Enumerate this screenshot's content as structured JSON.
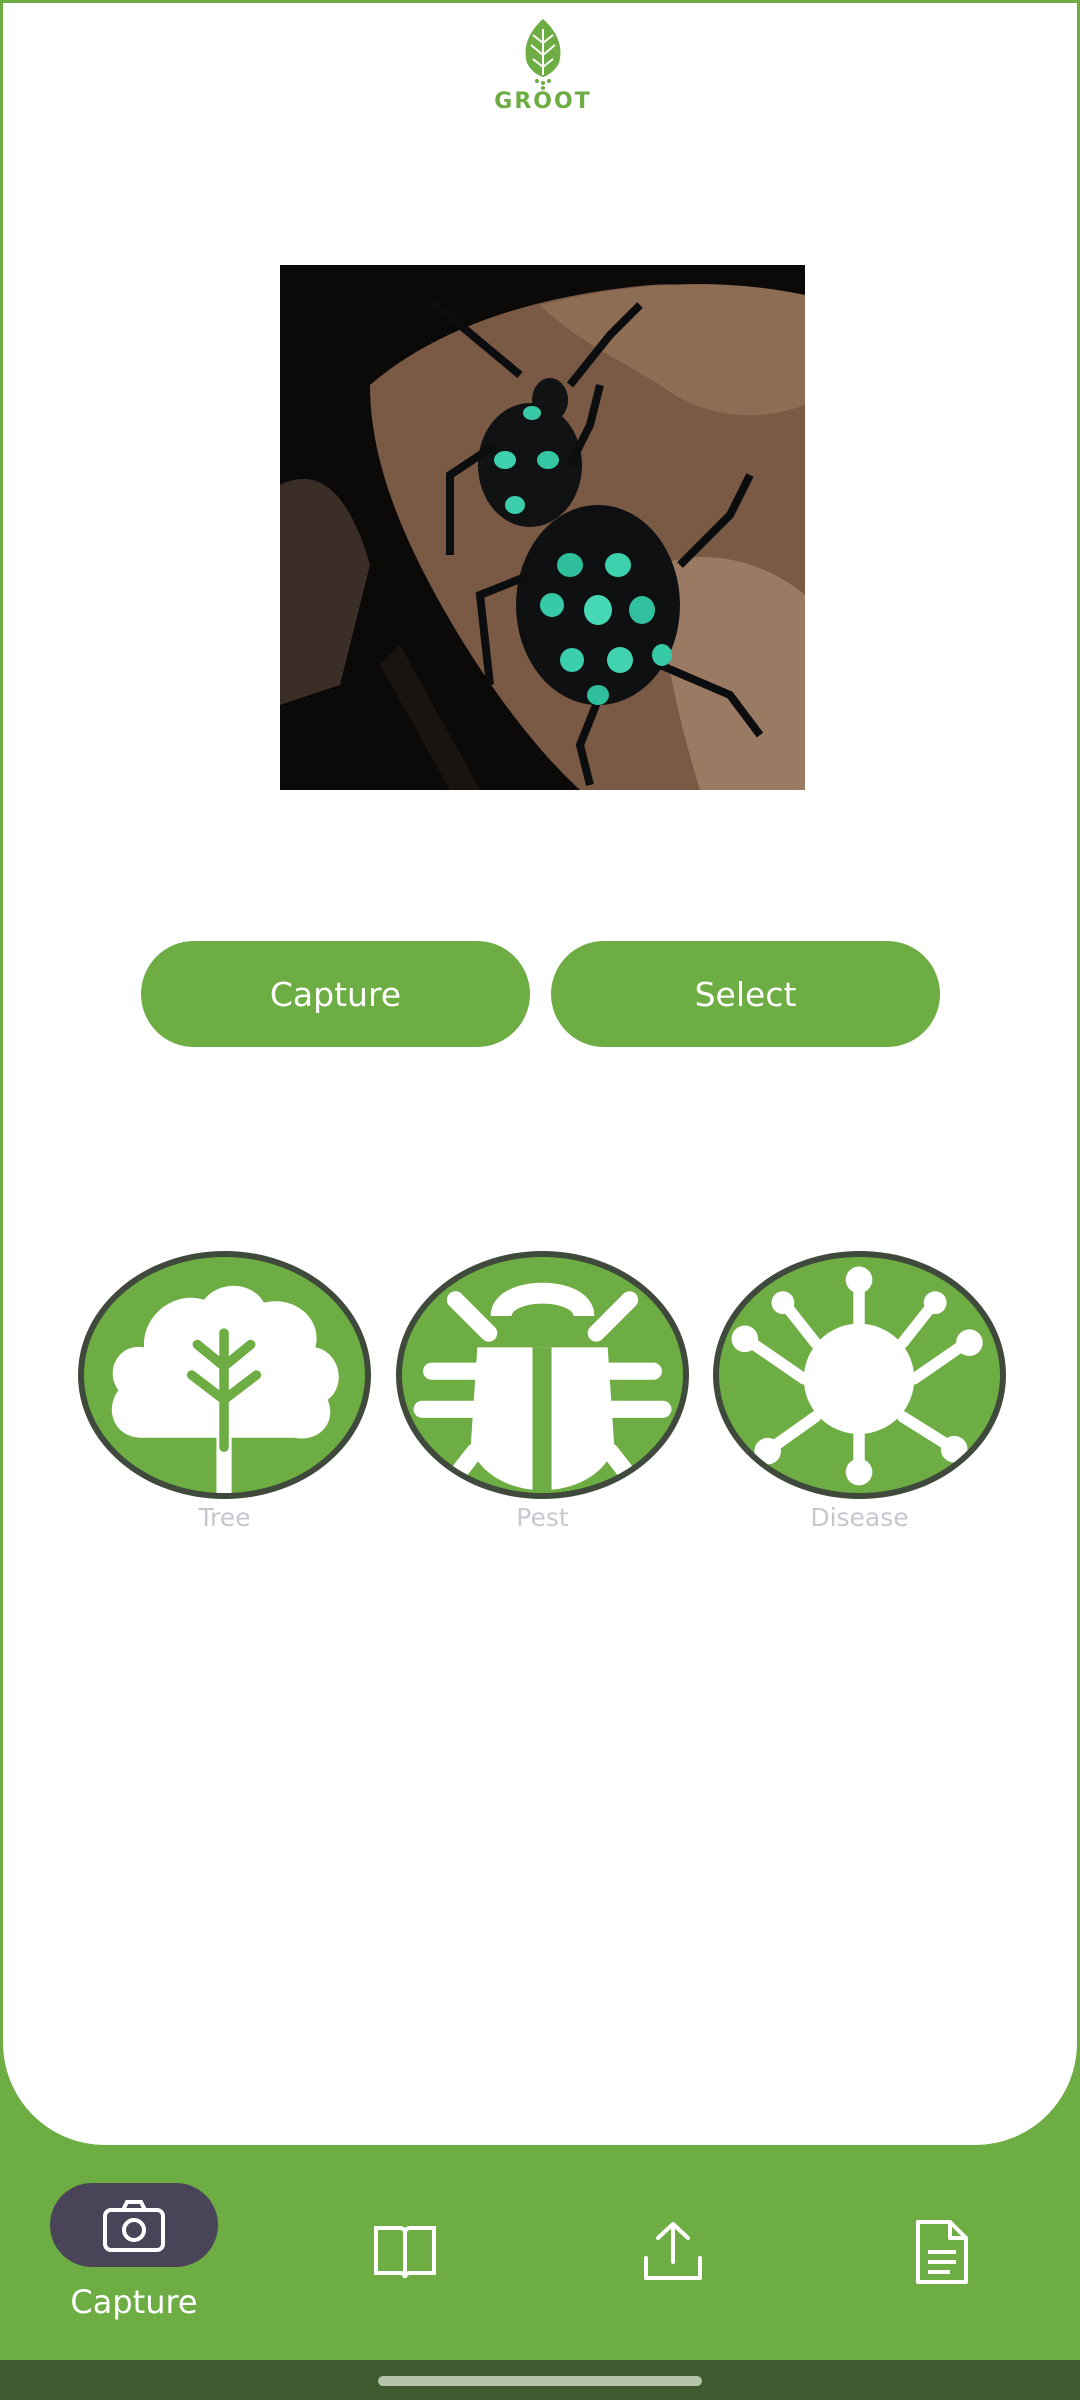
{
  "app": {
    "logo_text": "GROOT"
  },
  "actions": {
    "capture_label": "Capture",
    "select_label": "Select"
  },
  "categories": [
    {
      "label": "Tree",
      "icon": "tree-icon"
    },
    {
      "label": "Pest",
      "icon": "bug-icon"
    },
    {
      "label": "Disease",
      "icon": "virus-icon"
    }
  ],
  "bottom_nav": {
    "items": [
      {
        "label": "Capture",
        "icon": "camera-icon",
        "active": true
      },
      {
        "label": "",
        "icon": "book-icon",
        "active": false
      },
      {
        "label": "",
        "icon": "upload-icon",
        "active": false
      },
      {
        "label": "",
        "icon": "document-icon",
        "active": false
      }
    ]
  },
  "colors": {
    "primary": "#6dad43",
    "nav_active": "#4a4458",
    "circle_border": "#3f4a3c"
  }
}
